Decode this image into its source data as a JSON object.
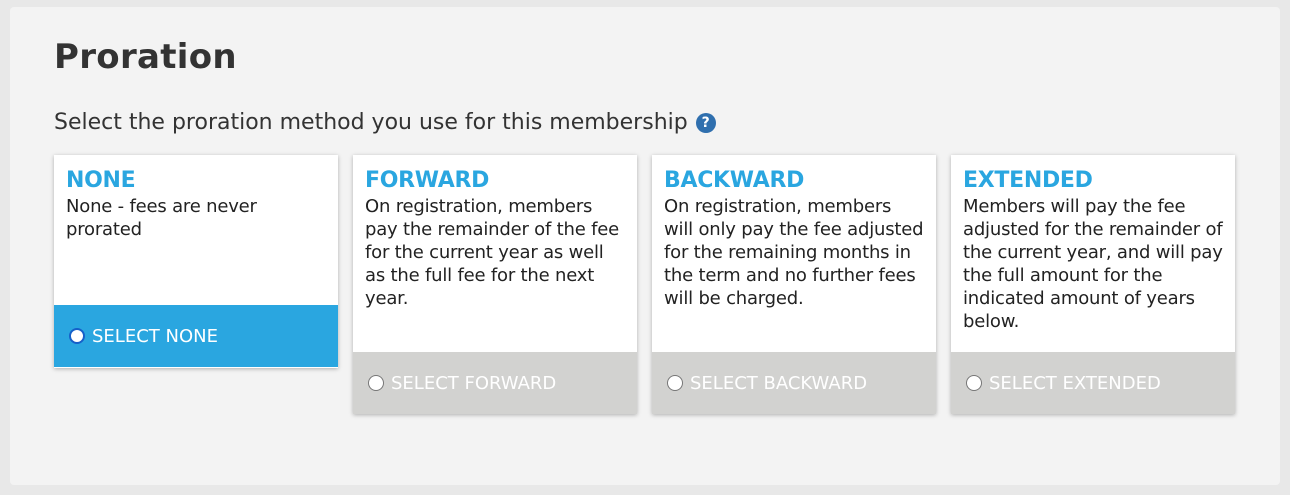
{
  "section": {
    "title": "Proration",
    "subtitle": "Select the proration method you use for this membership",
    "help_icon": "question-circle-icon"
  },
  "options": [
    {
      "title": "NONE",
      "description": "None - fees are never prorated",
      "select_label": "SELECT NONE",
      "selected": true
    },
    {
      "title": "FORWARD",
      "description": "On registration, members pay the remainder of the fee for the current year as well as the full fee for the next year.",
      "select_label": "SELECT FORWARD",
      "selected": false
    },
    {
      "title": "BACKWARD",
      "description": "On registration, members will only pay the fee adjusted for the remaining months in the term and no further fees will be charged.",
      "select_label": "SELECT BACKWARD",
      "selected": false
    },
    {
      "title": "EXTENDED",
      "description": "Members will pay the fee adjusted for the remainder of the current year, and will pay the full amount for the indicated amount of years below.",
      "select_label": "SELECT EXTENDED",
      "selected": false
    }
  ],
  "colors": {
    "accent": "#2aa6e0",
    "unselected_footer": "#d2d2d0",
    "help_icon": "#2f6fae"
  }
}
